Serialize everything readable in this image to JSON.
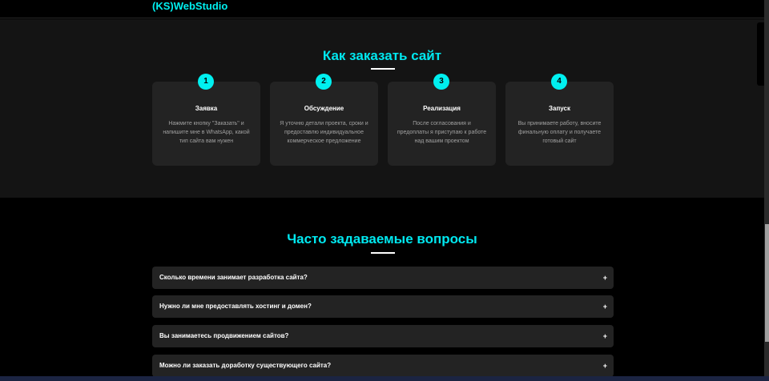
{
  "header": {
    "logo": "(KS)WebStudio"
  },
  "steps": {
    "title": "Как заказать сайт",
    "items": [
      {
        "num": "1",
        "title": "Заявка",
        "text": "Нажмите кнопку \"Заказать\" и напишите мне в WhatsApp, какой тип сайта вам нужен"
      },
      {
        "num": "2",
        "title": "Обсуждение",
        "text": "Я уточню детали проекта, сроки и предоставлю индивидуальное коммерческое предложение"
      },
      {
        "num": "3",
        "title": "Реализация",
        "text": "После согласования и предоплаты я приступаю к работе над вашим проектом"
      },
      {
        "num": "4",
        "title": "Запуск",
        "text": "Вы принимаете работу, вносите финальную оплату и получаете готовый сайт"
      }
    ]
  },
  "faq": {
    "title": "Часто задаваемые вопросы",
    "items": [
      {
        "q": "Сколько времени занимает разработка сайта?",
        "icon": "+"
      },
      {
        "q": "Нужно ли мне предоставлять хостинг и домен?",
        "icon": "+"
      },
      {
        "q": "Вы занимаетесь продвижением сайтов?",
        "icon": "+"
      },
      {
        "q": "Можно ли заказать доработку существующего сайта?",
        "icon": "+"
      }
    ]
  }
}
